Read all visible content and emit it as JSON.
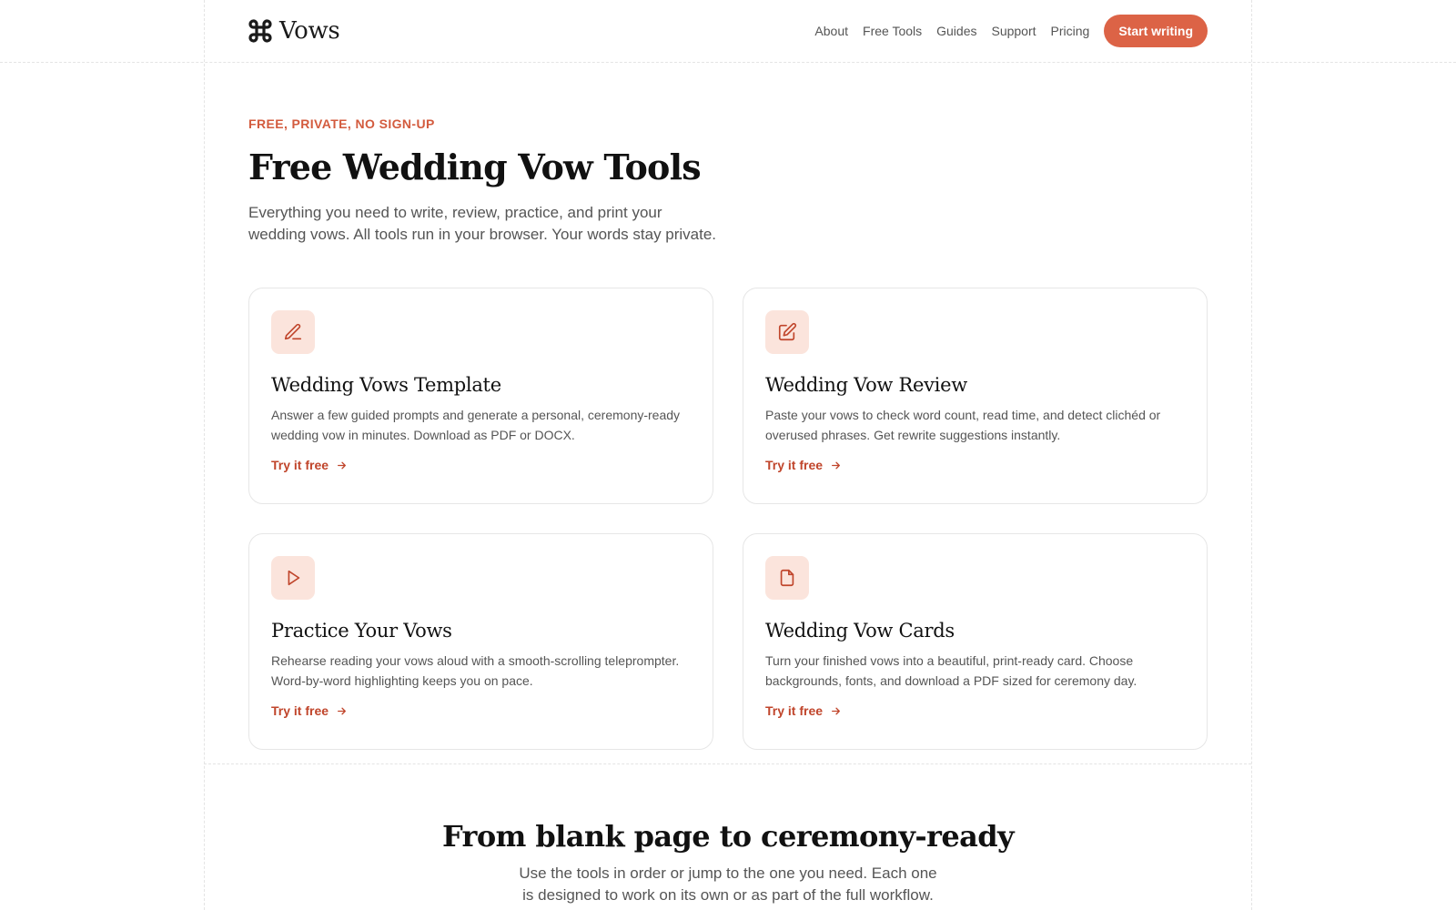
{
  "brand": {
    "name": "Vows",
    "icon": "command-icon",
    "accent": "#dc6346"
  },
  "nav": {
    "items": [
      "About",
      "Free Tools",
      "Guides",
      "Support",
      "Pricing"
    ],
    "cta": "Start writing"
  },
  "hero": {
    "eyebrow": "FREE, PRIVATE, NO SIGN-UP",
    "title": "Free Wedding Vow Tools",
    "lede": "Everything you need to write, review, practice, and print your wedding vows. All tools run in your browser. Your words stay private."
  },
  "cards": [
    {
      "icon": "pen-icon",
      "title": "Wedding Vows Template",
      "desc": "Answer a few guided prompts and generate a personal, ceremony-ready wedding vow in minutes. Download as PDF or DOCX.",
      "link": "Try it free"
    },
    {
      "icon": "edit-square-icon",
      "title": "Wedding Vow Review",
      "desc": "Paste your vows to check word count, read time, and detect clichéd or overused phrases. Get rewrite suggestions instantly.",
      "link": "Try it free"
    },
    {
      "icon": "play-icon",
      "title": "Practice Your Vows",
      "desc": "Rehearse reading your vows aloud with a smooth-scrolling teleprompter. Word-by-word highlighting keeps you on pace.",
      "link": "Try it free"
    },
    {
      "icon": "document-icon",
      "title": "Wedding Vow Cards",
      "desc": "Turn your finished vows into a beautiful, print-ready card. Choose backgrounds, fonts, and download a PDF sized for ceremony day.",
      "link": "Try it free"
    }
  ],
  "section2": {
    "title": "From blank page to ceremony-ready",
    "lede": "Use the tools in order or jump to the one you need. Each one is designed to work on its own or as part of the full workflow."
  }
}
